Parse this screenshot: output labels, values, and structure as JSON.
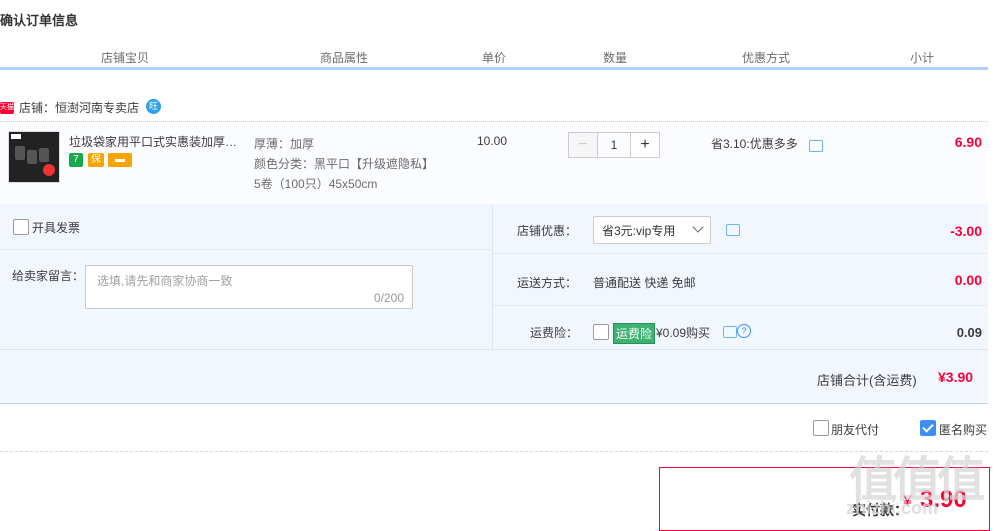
{
  "page": {
    "title": "确认订单信息"
  },
  "table_headers": [
    "店铺宝贝",
    "商品属性",
    "单价",
    "数量",
    "优惠方式",
    "小计"
  ],
  "shop": {
    "badge": "天猫",
    "label": "店铺：恒澍河南专卖店",
    "chat_icon": "wangwang-icon"
  },
  "item": {
    "name": "垃圾袋家用平口式实惠装加厚黑色塑料袋",
    "attributes": [
      "厚薄：加厚",
      "颜色分类：黑平口【升级遮隐私】",
      "5卷（100只）45x50cm"
    ],
    "unit_price": "10.00",
    "quantity": "1",
    "promotion": "省3.10:优惠多多",
    "subtotal": "6.90",
    "badge_colors": [
      "#52c41a",
      "#f5a623",
      "#f5a623"
    ]
  },
  "invoice": {
    "label": "开具发票",
    "checked": false
  },
  "message": {
    "label": "给卖家留言：",
    "placeholder": "选填,请先和商家协商一致",
    "counter": "0/200"
  },
  "shop_discount": {
    "label": "店铺优惠：",
    "selected": "省3元:vip专用",
    "amount": "-3.00"
  },
  "shipping": {
    "label": "运送方式：",
    "value": "普通配送 快递 免邮",
    "amount": "0.00"
  },
  "insurance": {
    "label": "运费险：",
    "tag": "运费险",
    "price_text": "¥0.09购买",
    "amount": "0.09",
    "checked": false
  },
  "shop_total": {
    "label": "店铺合计(含运费)",
    "amount": "¥3.90"
  },
  "options": {
    "friend_pay": {
      "label": "朋友代付",
      "checked": false
    },
    "anonymous": {
      "label": "匿名购买",
      "checked": true
    }
  },
  "payment": {
    "label": "实付款：",
    "currency": "¥",
    "amount": "3.90"
  },
  "watermark": {
    "text": "值值值",
    "sub": "zhizhi.com"
  },
  "colors": {
    "accent": "#ff0036",
    "line": "#b2d1ff",
    "panel": "#f2f7ff",
    "checkbox": "#3e8ef7"
  }
}
